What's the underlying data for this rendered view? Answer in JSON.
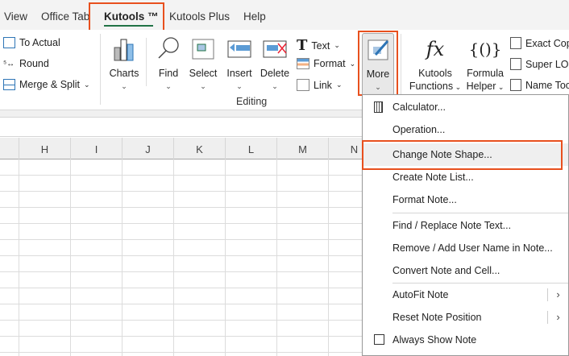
{
  "tabs": [
    "View",
    "Office Tab",
    "Kutools ™",
    "Kutools Plus",
    "Help"
  ],
  "active_tab": "Kutools ™",
  "ribbon": {
    "small_left": [
      "To Actual",
      "Round",
      "Merge & Split"
    ],
    "charts": "Charts",
    "find": "Find",
    "select": "Select",
    "insert": "Insert",
    "delete": "Delete",
    "small_mid": [
      "Text",
      "Format",
      "Link"
    ],
    "more": "More",
    "kutools_functions": [
      "Kutools",
      "Functions"
    ],
    "formula_helper": [
      "Formula",
      "Helper"
    ],
    "small_right": [
      "Exact Cop",
      "Super LOC",
      "Name Too"
    ],
    "group_label": "Editing"
  },
  "columns": [
    "H",
    "I",
    "J",
    "K",
    "L",
    "M",
    "N"
  ],
  "menu": {
    "items": [
      "Calculator...",
      "Operation...",
      "Change Note Shape...",
      "Create Note List...",
      "Format Note...",
      "Find / Replace Note Text...",
      "Remove / Add User Name in Note...",
      "Convert Note and Cell...",
      "AutoFit Note",
      "Reset Note Position",
      "Always Show Note"
    ],
    "selected": "Change Note Shape..."
  },
  "colors": {
    "highlight": "#e8501e",
    "tab_underline": "#217346"
  }
}
